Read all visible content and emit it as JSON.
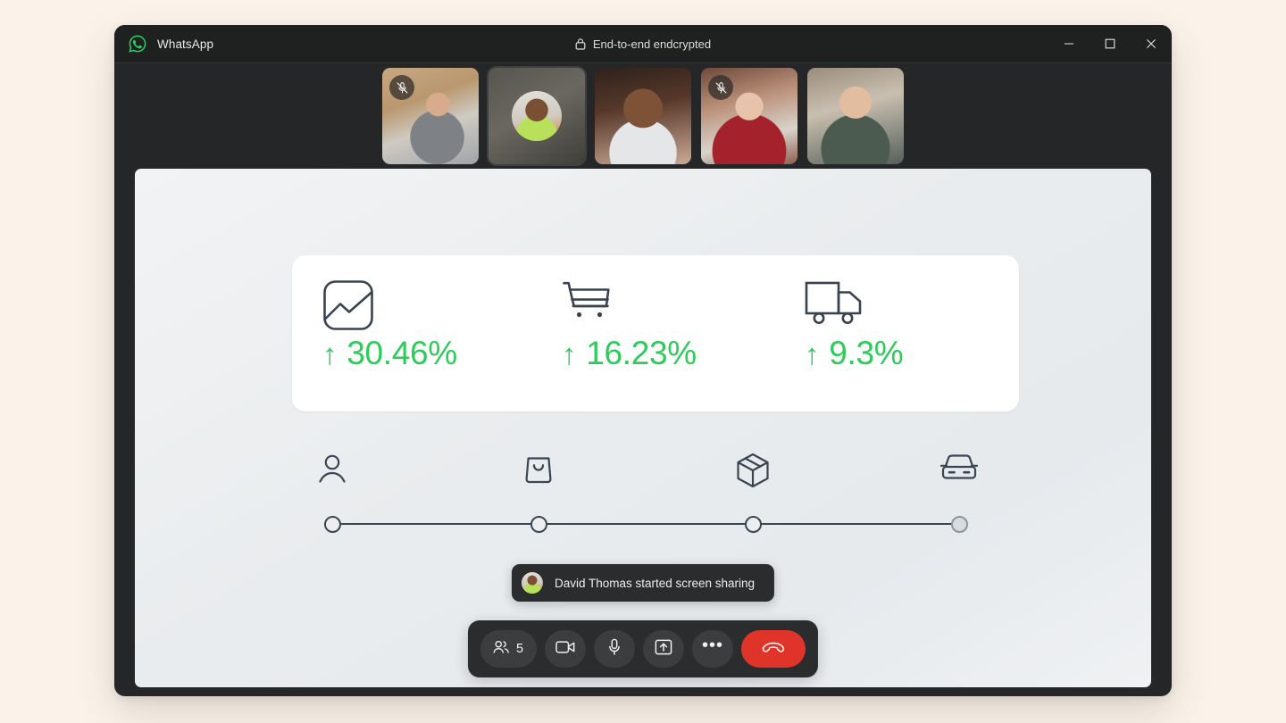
{
  "window": {
    "app_title": "WhatsApp",
    "logo_icon": "whatsapp-logo-icon",
    "encryption_label": "End-to-end endcrypted",
    "lock_icon": "lock-icon",
    "controls": {
      "minimize_icon": "minimize-icon",
      "maximize_icon": "maximize-icon",
      "close_icon": "close-icon"
    }
  },
  "participants": [
    {
      "name": "participant-1",
      "muted": true,
      "camera_on": true,
      "selected": false,
      "mic_icon": "mic-off-icon"
    },
    {
      "name": "participant-2",
      "muted": false,
      "camera_on": false,
      "selected": true,
      "mic_icon": ""
    },
    {
      "name": "participant-3",
      "muted": false,
      "camera_on": true,
      "selected": false,
      "mic_icon": ""
    },
    {
      "name": "participant-4",
      "muted": true,
      "camera_on": true,
      "selected": false,
      "mic_icon": "mic-off-icon"
    },
    {
      "name": "participant-5",
      "muted": false,
      "camera_on": true,
      "selected": false,
      "mic_icon": ""
    }
  ],
  "shared_screen": {
    "stats": [
      {
        "icon": "image-chart-icon",
        "arrow": "↑",
        "value": "30.46%"
      },
      {
        "icon": "shopping-cart-icon",
        "arrow": "↑",
        "value": "16.23%"
      },
      {
        "icon": "delivery-truck-icon",
        "arrow": "↑",
        "value": "9.3%"
      }
    ],
    "accent_color": "#2ecb5b",
    "stepper": {
      "steps": [
        {
          "icon": "user-icon",
          "position": 0,
          "filled": false
        },
        {
          "icon": "shopping-bag-icon",
          "position": 33,
          "filled": false
        },
        {
          "icon": "package-box-icon",
          "position": 66.5,
          "filled": false
        },
        {
          "icon": "car-icon",
          "position": 100,
          "filled": true
        }
      ]
    }
  },
  "toast": {
    "avatar_icon": "participant-avatar",
    "message": "David Thomas started screen sharing"
  },
  "call_controls": {
    "participants_icon": "people-icon",
    "participants_count": "5",
    "camera_icon": "video-camera-icon",
    "microphone_icon": "microphone-icon",
    "share_screen_icon": "share-screen-icon",
    "more_icon": "more-options-icon",
    "more_label": "•••",
    "end_call_icon": "end-call-icon",
    "end_call_color": "#e0342a"
  }
}
